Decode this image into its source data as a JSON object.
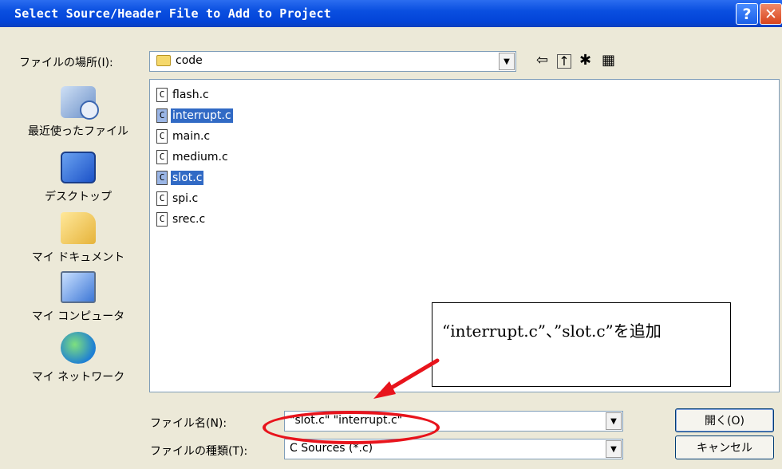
{
  "window": {
    "title": "Select Source/Header File to Add to Project",
    "help_glyph": "?",
    "close_glyph": "✕"
  },
  "lookin": {
    "label": "ファイルの場所(I):",
    "value": "code"
  },
  "places": [
    {
      "label": "最近使ったファイル",
      "icon": "recent-files-icon"
    },
    {
      "label": "デスクトップ",
      "icon": "desktop-icon"
    },
    {
      "label": "マイ ドキュメント",
      "icon": "my-documents-icon"
    },
    {
      "label": "マイ コンピュータ",
      "icon": "my-computer-icon"
    },
    {
      "label": "マイ ネットワーク",
      "icon": "my-network-icon"
    }
  ],
  "files": [
    {
      "name": "flash.c",
      "selected": false
    },
    {
      "name": "interrupt.c",
      "selected": true
    },
    {
      "name": "main.c",
      "selected": false
    },
    {
      "name": "medium.c",
      "selected": false
    },
    {
      "name": "slot.c",
      "selected": true
    },
    {
      "name": "spi.c",
      "selected": false
    },
    {
      "name": "srec.c",
      "selected": false
    }
  ],
  "file_icon_glyph": "C",
  "filename": {
    "label": "ファイル名(N):",
    "value": "\"slot.c\" \"interrupt.c\""
  },
  "filetype": {
    "label": "ファイルの種類(T):",
    "value": "C Sources (*.c)"
  },
  "buttons": {
    "open": "開く(O)",
    "cancel": "キャンセル"
  },
  "callout": {
    "text": "“interrupt.c”、”slot.c”を追加"
  },
  "colors": {
    "selection": "#316ac5",
    "annotation": "#e8141c"
  }
}
